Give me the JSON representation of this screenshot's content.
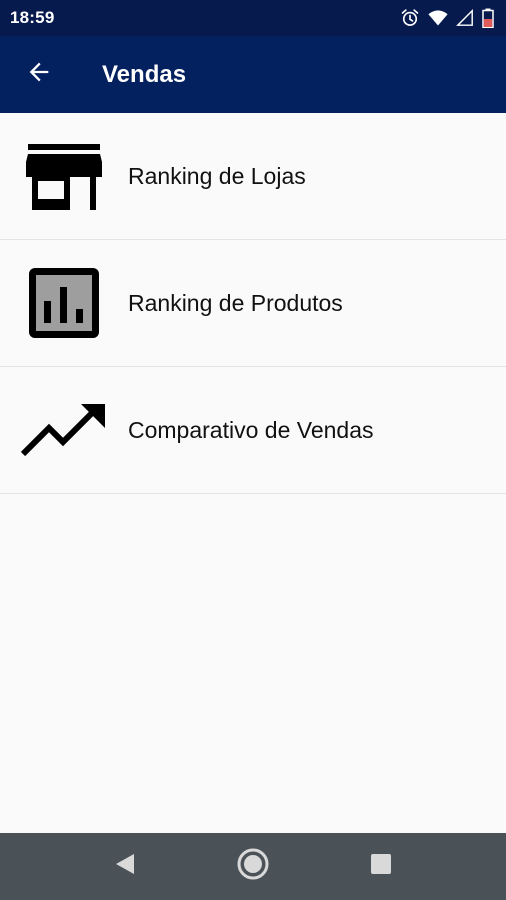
{
  "status_bar": {
    "time": "18:59",
    "icons": [
      "alarm-icon",
      "wifi-icon",
      "signal-icon",
      "battery-icon"
    ]
  },
  "app_bar": {
    "title": "Vendas",
    "back_icon": "arrow-left-icon"
  },
  "menu": {
    "items": [
      {
        "label": "Ranking de Lojas",
        "icon": "store-icon"
      },
      {
        "label": "Ranking de Produtos",
        "icon": "bar-chart-icon"
      },
      {
        "label": "Comparativo de Vendas",
        "icon": "trending-up-icon"
      }
    ]
  },
  "nav_bar": {
    "buttons": [
      "back-triangle-icon",
      "home-circle-icon",
      "recents-square-icon"
    ]
  },
  "colors": {
    "status_bar": "#061a4e",
    "app_bar": "#03215f",
    "background": "#fafafa",
    "nav_bar": "#4b5257"
  }
}
